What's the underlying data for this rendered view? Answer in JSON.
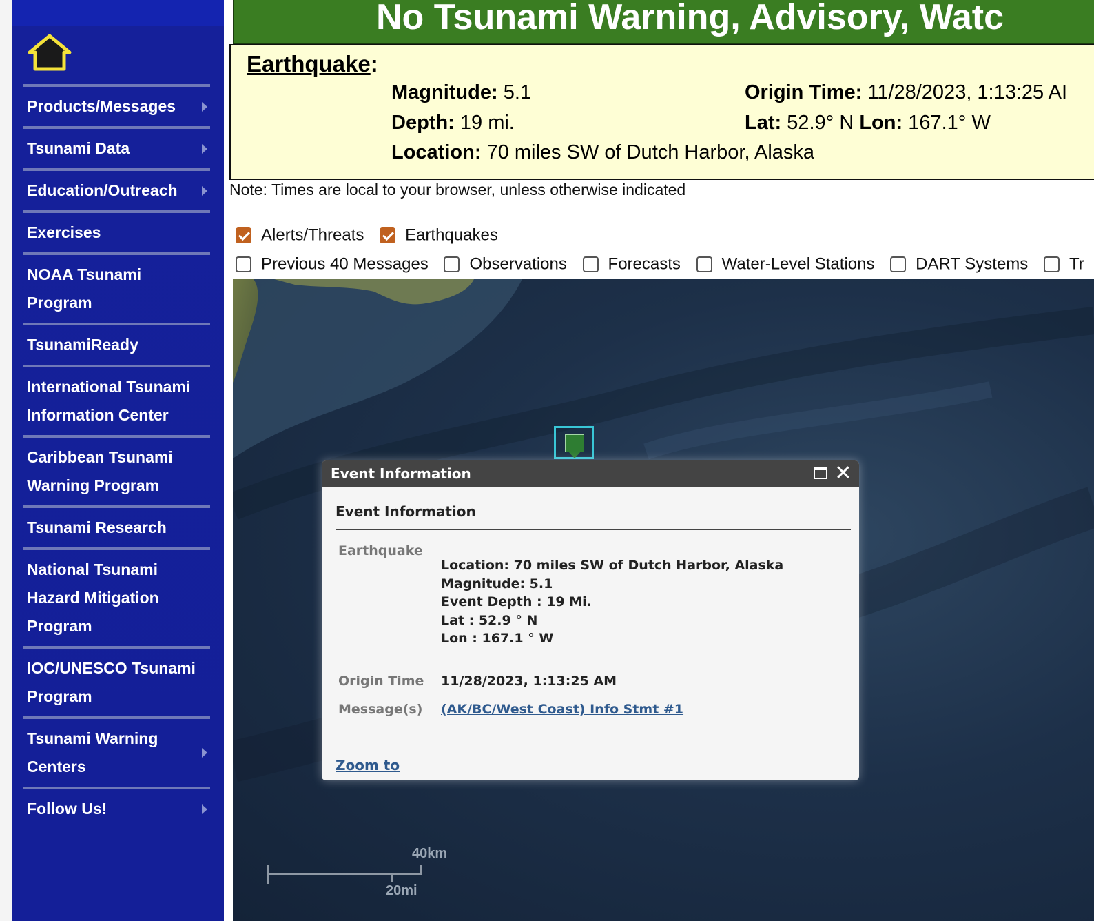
{
  "sidebar": {
    "items": [
      {
        "label": "Products/Messages",
        "submenu": true
      },
      {
        "label": "Tsunami Data",
        "submenu": true
      },
      {
        "label": "Education/Outreach",
        "submenu": true
      },
      {
        "label": "Exercises",
        "submenu": false
      },
      {
        "label": "NOAA Tsunami Program",
        "submenu": false
      },
      {
        "label": "TsunamiReady",
        "submenu": false
      },
      {
        "label": "International Tsunami Information Center",
        "submenu": false
      },
      {
        "label": "Caribbean Tsunami Warning Program",
        "submenu": false
      },
      {
        "label": "Tsunami Research",
        "submenu": false
      },
      {
        "label": "National Tsunami Hazard Mitigation Program",
        "submenu": false
      },
      {
        "label": "IOC/UNESCO Tsunami Program",
        "submenu": false
      },
      {
        "label": "Tsunami Warning Centers",
        "submenu": true
      },
      {
        "label": "Follow Us!",
        "submenu": true
      }
    ]
  },
  "banner": {
    "text": "No Tsunami Warning, Advisory, Watc"
  },
  "earthquake": {
    "title": "Earthquake",
    "magnitude_label": "Magnitude:",
    "magnitude": "5.1",
    "depth_label": "Depth:",
    "depth": "19 mi.",
    "location_label": "Location:",
    "location": "70 miles SW of Dutch Harbor, Alaska",
    "origin_label": "Origin Time:",
    "origin": "11/28/2023, 1:13:25 AI",
    "lat_label": "Lat:",
    "lat": "52.9° N",
    "lon_label": "Lon:",
    "lon": "167.1° W"
  },
  "note": "Note: Times are local to your browser, unless otherwise indicated",
  "layers": {
    "row1": [
      {
        "label": "Alerts/Threats",
        "checked": true
      },
      {
        "label": "Earthquakes",
        "checked": true
      }
    ],
    "row2": [
      {
        "label": "Previous 40 Messages",
        "checked": false
      },
      {
        "label": "Observations",
        "checked": false
      },
      {
        "label": "Forecasts",
        "checked": false
      },
      {
        "label": "Water-Level Stations",
        "checked": false
      },
      {
        "label": "DART Systems",
        "checked": false
      },
      {
        "label": "Tr",
        "checked": false
      }
    ]
  },
  "map": {
    "scale_km": "40km",
    "scale_mi": "20mi"
  },
  "popup": {
    "header": "Event Information",
    "title": "Event Information",
    "earthquake_label": "Earthquake",
    "location": "Location: 70 miles SW of Dutch Harbor, Alaska",
    "magnitude": "Magnitude: 5.1",
    "depth": "Event Depth : 19 Mi.",
    "lat": "Lat : 52.9 ° N",
    "lon": "Lon : 167.1 ° W",
    "origin_label": "Origin Time",
    "origin": "11/28/2023, 1:13:25 AM",
    "messages_label": "Message(s)",
    "message_link": "(AK/BC/West Coast) Info Stmt #1",
    "zoom": "Zoom to"
  },
  "colors": {
    "sidebar": "#141f98",
    "banner": "#3a7d22",
    "eqbox": "#fefed5",
    "checkbox_on": "#c0611f",
    "link": "#2f5a8e"
  }
}
